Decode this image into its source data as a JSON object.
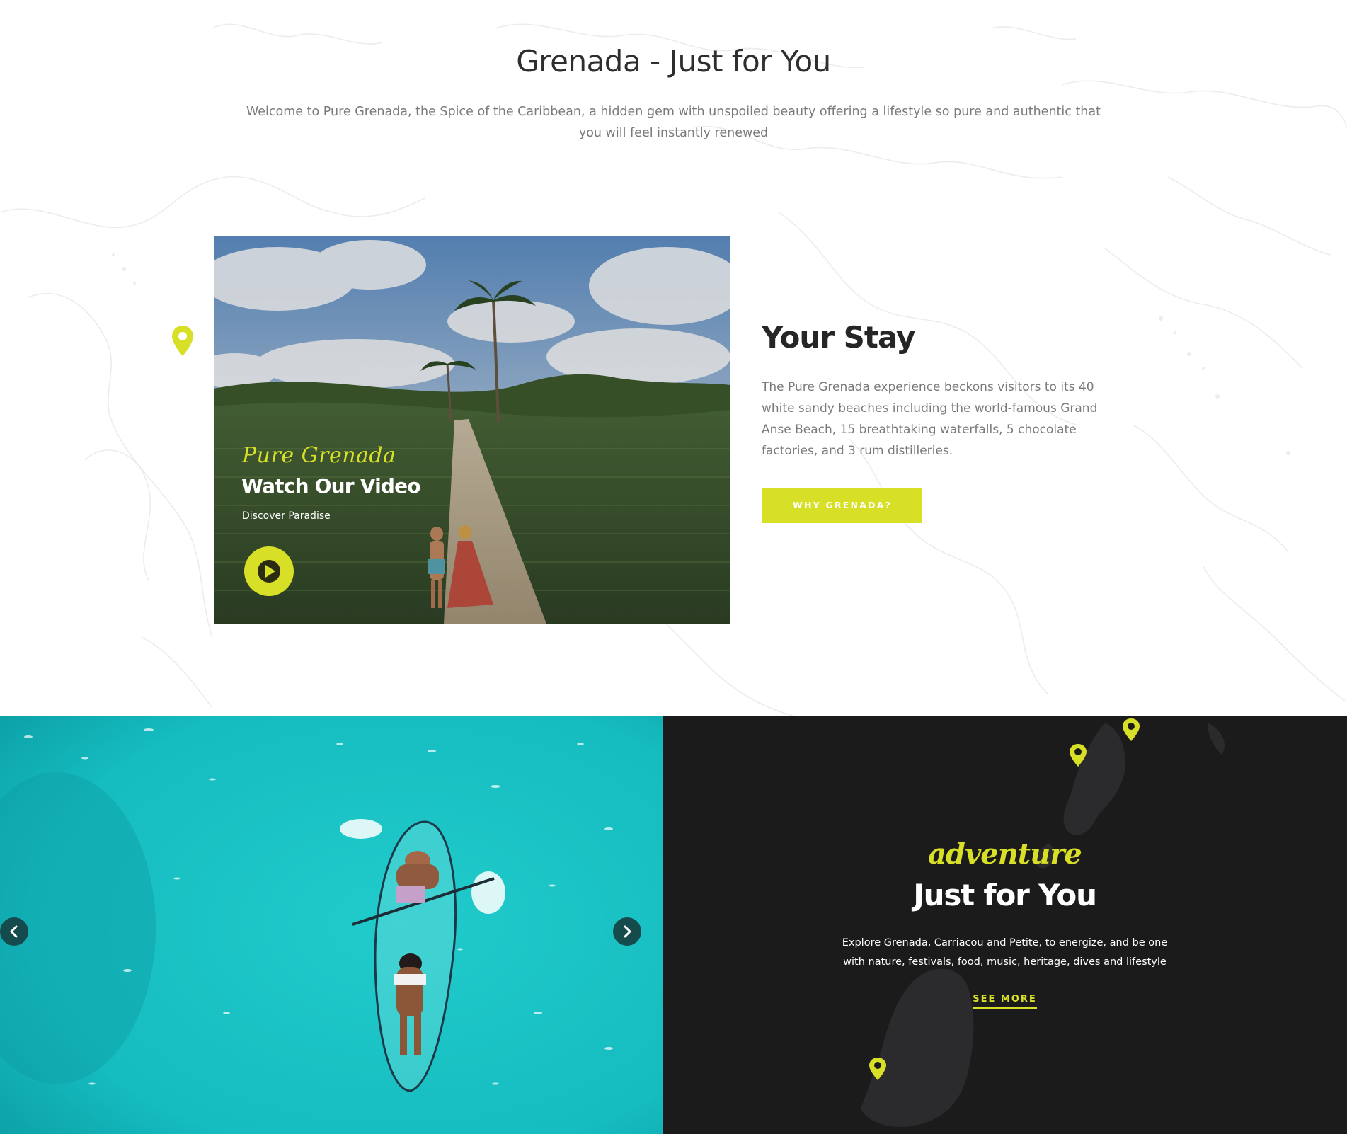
{
  "colors": {
    "accent": "#d7df26",
    "dark": "#1b1b1c",
    "sea": "#1cc3c6",
    "text_muted": "#7a7a7a"
  },
  "intro": {
    "title": "Grenada - Just for You",
    "text": "Welcome to Pure Grenada, the Spice of the Caribbean, a hidden gem with unspoiled beauty offering a lifestyle so pure and authentic that you will feel instantly renewed"
  },
  "video": {
    "script_label": "Pure Grenada",
    "title": "Watch Our Video",
    "subtitle": "Discover Paradise",
    "play_icon": "play-icon"
  },
  "stay": {
    "title": "Your Stay",
    "text": "The Pure Grenada experience beckons visitors to its 40 white sandy beaches including the world-famous Grand Anse Beach, 15 breathtaking waterfalls, 5 chocolate factories, and 3 rum distilleries.",
    "button_label": "WHY GRENADA?"
  },
  "slider": {
    "prev_icon": "chevron-left-icon",
    "next_icon": "chevron-right-icon"
  },
  "adventure": {
    "script_label": "adventure",
    "title": "Just for You",
    "text": "Explore Grenada, Carriacou and Petite, to energize, and be one with nature, festivals, food, music, heritage, dives and lifestyle",
    "link_label": "SEE MORE"
  }
}
